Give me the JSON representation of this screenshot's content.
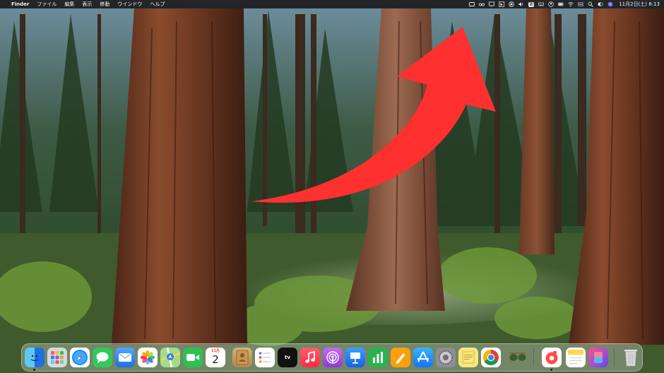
{
  "menubar": {
    "apple_glyph": "",
    "app_name": "Finder",
    "menus": [
      "ファイル",
      "編集",
      "表示",
      "移動",
      "ウインドウ",
      "ヘルプ"
    ],
    "input_method": "あ",
    "clock": "11月2日(土)  8:13"
  },
  "dock": {
    "calendar_month": "11月",
    "calendar_day": "2",
    "tv_label": "tv",
    "apps": [
      {
        "name": "Finder",
        "icon": "finder-icon",
        "color": "#1e88e5"
      },
      {
        "name": "Launchpad",
        "icon": "launchpad-icon",
        "color": "#9aa5b1"
      },
      {
        "name": "Safari",
        "icon": "safari-icon",
        "color": "#1a73e8"
      },
      {
        "name": "Messages",
        "icon": "messages-icon",
        "color": "#34c759"
      },
      {
        "name": "Mail",
        "icon": "mail-icon",
        "color": "#2f7df6"
      },
      {
        "name": "Photos",
        "icon": "photos-icon",
        "color": "#ffffff"
      },
      {
        "name": "Maps",
        "icon": "maps-icon",
        "color": "#63c26b"
      },
      {
        "name": "FaceTime",
        "icon": "facetime-icon",
        "color": "#30c04f"
      },
      {
        "name": "Calendar",
        "icon": "calendar-icon",
        "color": "#ffffff"
      },
      {
        "name": "Contacts",
        "icon": "contacts-icon",
        "color": "#c9a56b"
      },
      {
        "name": "Reminders",
        "icon": "reminders-icon",
        "color": "#ffffff"
      },
      {
        "name": "TV",
        "icon": "tv-icon",
        "color": "#111111"
      },
      {
        "name": "Music",
        "icon": "music-icon",
        "color": "#fa3c4c"
      },
      {
        "name": "Podcasts",
        "icon": "podcasts-icon",
        "color": "#9b4ee8"
      },
      {
        "name": "Keynote",
        "icon": "keynote-icon",
        "color": "#1f8fff"
      },
      {
        "name": "Numbers",
        "icon": "numbers-icon",
        "color": "#2bb24c"
      },
      {
        "name": "Pages",
        "icon": "pages-icon",
        "color": "#ff9f0a"
      },
      {
        "name": "App Store",
        "icon": "app-store-icon",
        "color": "#1c8cf5"
      },
      {
        "name": "System Settings",
        "icon": "settings-icon",
        "color": "#8e8e93"
      },
      {
        "name": "Stickies",
        "icon": "stickies-icon",
        "color": "#f7e87a"
      },
      {
        "name": "Chrome",
        "icon": "chrome-icon",
        "color": "#ffffff"
      },
      {
        "name": "Preview",
        "icon": "sunglasses-icon",
        "color": "#6b8e5a"
      },
      {
        "name": "Scrobbles",
        "icon": "scrobbles-icon",
        "color": "#ff4b4b"
      },
      {
        "name": "Notes",
        "icon": "notes-icon",
        "color": "#ffd54f"
      },
      {
        "name": "Shortcuts",
        "icon": "shortcuts-icon",
        "color": "#5856d6"
      },
      {
        "name": "Trash",
        "icon": "trash-icon",
        "color": "#d8d8d8"
      }
    ]
  }
}
